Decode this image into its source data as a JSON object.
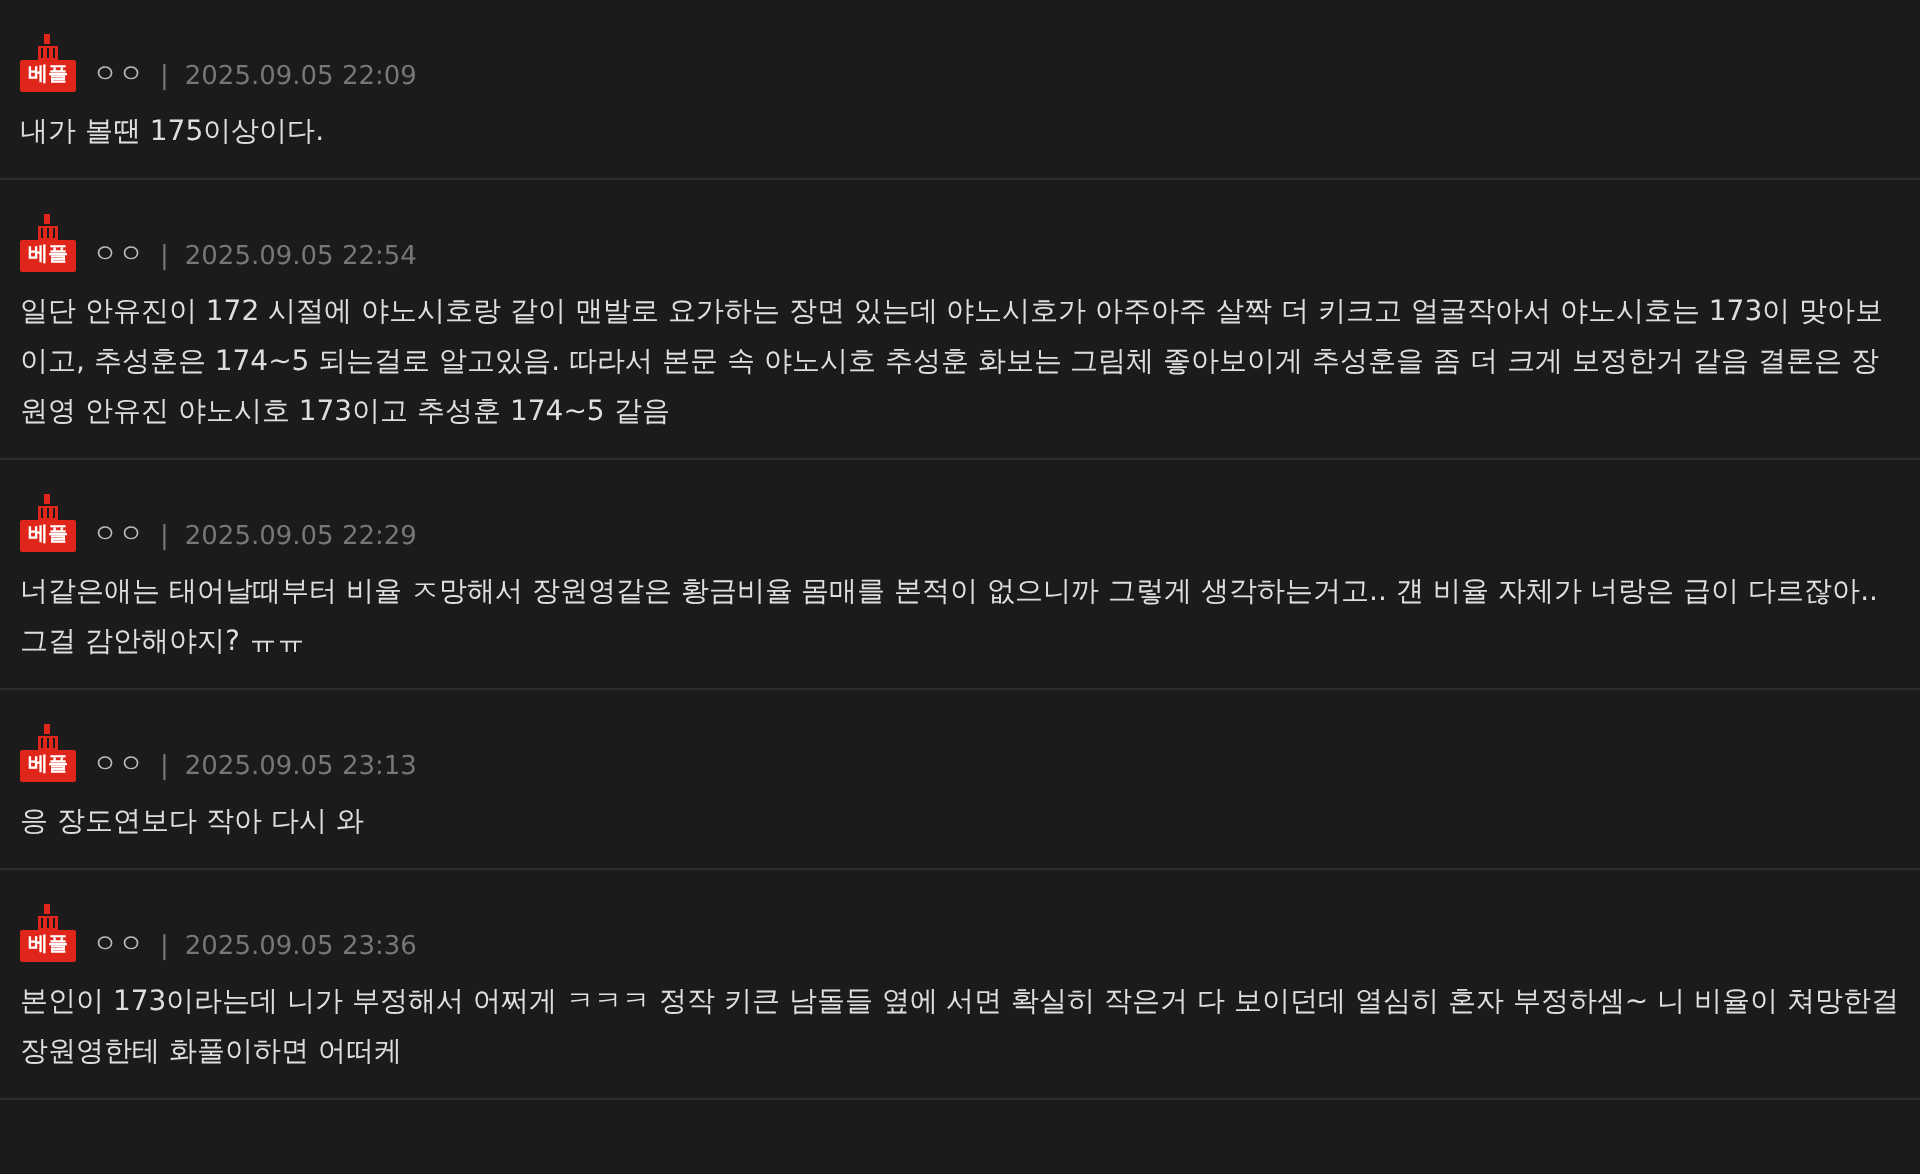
{
  "comments": [
    {
      "badge": "베플",
      "nickname": "ㅇㅇ",
      "separator": "|",
      "date": "2025.09.05 22:09",
      "body": "내가 볼땐 175이상이다."
    },
    {
      "badge": "베플",
      "nickname": "ㅇㅇ",
      "separator": "|",
      "date": "2025.09.05 22:54",
      "body": "일단 안유진이 172 시절에 야노시호랑 같이 맨발로 요가하는 장면 있는데 야노시호가 아주아주 살짝 더 키크고 얼굴작아서 야노시호는 173이 맞아보이고, 추성훈은 174~5 되는걸로 알고있음. 따라서 본문 속 야노시호 추성훈 화보는 그림체 좋아보이게 추성훈을 좀 더 크게 보정한거 같음 결론은 장원영 안유진 야노시호 173이고 추성훈 174~5 같음"
    },
    {
      "badge": "베플",
      "nickname": "ㅇㅇ",
      "separator": "|",
      "date": "2025.09.05 22:29",
      "body": "너같은애는 태어날때부터 비율 ㅈ망해서 장원영같은 황금비율 몸매를 본적이 없으니까 그렇게 생각하는거고.. 걘 비율 자체가 너랑은 급이 다르잖아.. 그걸 감안해야지? ㅠㅠ"
    },
    {
      "badge": "베플",
      "nickname": "ㅇㅇ",
      "separator": "|",
      "date": "2025.09.05 23:13",
      "body": "응 장도연보다 작아 다시 와"
    },
    {
      "badge": "베플",
      "nickname": "ㅇㅇ",
      "separator": "|",
      "date": "2025.09.05 23:36",
      "body": "본인이 173이라는데 니가 부정해서 어쩌게 ㅋㅋㅋ 정작 키큰 남돌들 옆에 서면 확실히 작은거 다 보이던데 열심히 혼자 부정하셈~ 니 비율이 쳐망한걸 장원영한테 화풀이하면 어떠케"
    }
  ]
}
